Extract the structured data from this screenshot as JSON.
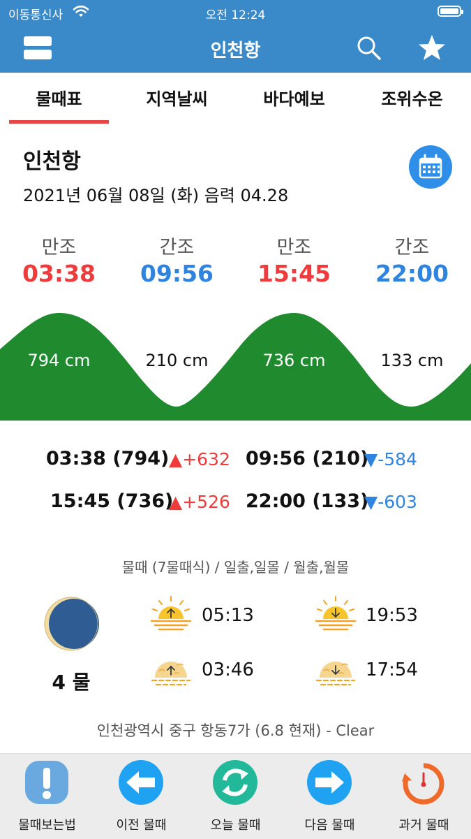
{
  "status_bar": {
    "carrier": "이동통신사",
    "time": "오전 12:24"
  },
  "nav": {
    "title": "인천항",
    "icons": [
      "menu-icon",
      "search-icon",
      "star-icon"
    ]
  },
  "tabs": [
    {
      "label": "물때표",
      "selected": true
    },
    {
      "label": "지역날씨",
      "selected": false
    },
    {
      "label": "바다예보",
      "selected": false
    },
    {
      "label": "조위수온",
      "selected": false
    }
  ],
  "location": {
    "name": "인천항",
    "date": "2021년 06월 08일 (화) 음력 04.28"
  },
  "tides": [
    {
      "type": "만조",
      "time": "03:38",
      "level": "794 cm",
      "kind": "high"
    },
    {
      "type": "간조",
      "time": "09:56",
      "level": "210 cm",
      "kind": "low"
    },
    {
      "type": "만조",
      "time": "15:45",
      "level": "736 cm",
      "kind": "high"
    },
    {
      "type": "간조",
      "time": "22:00",
      "level": "133 cm",
      "kind": "low"
    }
  ],
  "tide_details": [
    {
      "text": "03:38 (794)",
      "delta": "▲+632",
      "direction": "up"
    },
    {
      "text": "09:56 (210)",
      "delta": "▼-584",
      "direction": "down"
    },
    {
      "text": "15:45 (736)",
      "delta": "▲+526",
      "direction": "up"
    },
    {
      "text": "22:00 (133)",
      "delta": "▼-603",
      "direction": "down"
    }
  ],
  "caption": "물때 (7물때식) / 일출,일몰 / 월출,월몰",
  "moon_phase": {
    "label": "4 물"
  },
  "sun_moon": {
    "sunrise": "05:13",
    "sunset": "19:53",
    "moonrise": "03:46",
    "moonset": "17:54"
  },
  "location_line": "인천광역시 중구 항동7가 (6.8 현재) - Clear",
  "toolbar": [
    {
      "label": "물때보는법",
      "icon": "exclamation-icon"
    },
    {
      "label": "이전 물때",
      "icon": "arrow-left-icon"
    },
    {
      "label": "오늘 물때",
      "icon": "refresh-icon"
    },
    {
      "label": "다음 물때",
      "icon": "arrow-right-icon"
    },
    {
      "label": "과거 물때",
      "icon": "history-icon"
    }
  ],
  "colors": {
    "header": "#3a89c9",
    "high_tide": "#ef3b3b",
    "low_tide": "#2f84e0",
    "wave": "#1f8a2e",
    "tab_underline": "#e74545"
  }
}
